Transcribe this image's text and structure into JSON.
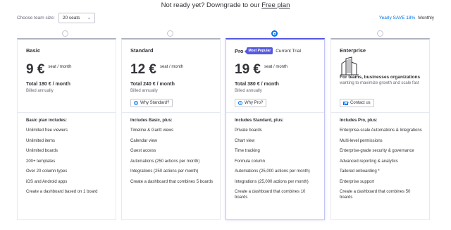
{
  "downgrade": {
    "prefix": "Not ready yet? Downgrade to our ",
    "link": "Free plan"
  },
  "team_size": {
    "label": "Choose team size:",
    "value": "20 seats"
  },
  "billing": {
    "yearly": "Yearly SAVE 18%",
    "monthly": "Monthly"
  },
  "plans": [
    {
      "name": "Basic",
      "price": "9 €",
      "per": "seat / month",
      "total": "Total 180 € / month",
      "billed": "Billed annually",
      "features_title": "Basic plan includes:",
      "features": [
        "Unlimited free viewers",
        "Unlimited items",
        "Unlimited boards",
        "200+ templates",
        "Over 20 column types",
        "iOS and Android apps",
        "Create a dashboard based on 1 board"
      ]
    },
    {
      "name": "Standard",
      "price": "12 €",
      "per": "seat / month",
      "total": "Total 240 € / month",
      "billed": "Billed annually",
      "why": "Why Standard?",
      "features_title": "Includes Basic, plus:",
      "features": [
        "Timeline & Gantt views",
        "Calendar view",
        "Guest access",
        "Automations (250 actions per month)",
        "Integrations (250 actions per month)",
        "Create a dashboard that combines 5 boards"
      ]
    },
    {
      "name": "Pro",
      "badge": "Most Popular",
      "trial": "Current Trial",
      "price": "19 €",
      "per": "seat / month",
      "total": "Total 380 € / month",
      "billed": "Billed annually",
      "why": "Why Pro?",
      "features_title": "Includes Standard, plus:",
      "features": [
        "Private boards",
        "Chart view",
        "Time tracking",
        "Formula column",
        "Automations (25,000 actions per month)",
        "Integrations (25,000 actions per month)",
        "Create a dashboard that combines 10 boards"
      ]
    },
    {
      "name": "Enterprise",
      "desc_bold": "For teams, businesses organizations",
      "desc": " wanting to maximize growth and scale fast",
      "contact": "Contact us",
      "features_title": "Includes Pro, plus:",
      "features": [
        "Enterprise-scale Automations & Integrations",
        "Multi-level permissions",
        "Enterprise-grade security & governance",
        "Advanced reporting & analytics",
        "Tailored onboarding *",
        "Enterprise support",
        "Create a dashboard that combines 50 boards"
      ]
    }
  ],
  "colors": {
    "accent": "#5559df",
    "link": "#0073ea",
    "text": "#323338",
    "muted": "#676879"
  },
  "icons": {
    "info": "info-icon",
    "contact": "mail-icon",
    "enterprise": "building-icon",
    "dropdown": "chevron-down-icon"
  }
}
